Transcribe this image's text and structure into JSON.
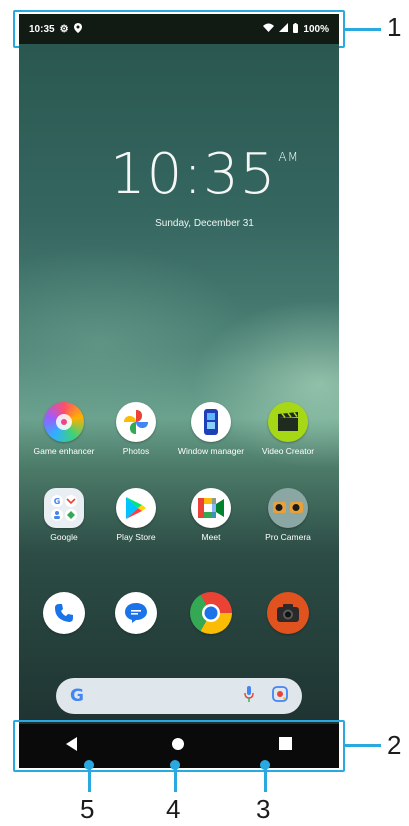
{
  "status_bar": {
    "time": "10:35",
    "battery": "100%",
    "icons": [
      "gear-icon",
      "location-icon",
      "wifi-icon",
      "signal-icon",
      "battery-icon"
    ]
  },
  "lock_clock": {
    "time": "10:35",
    "ampm": "AM",
    "date": "Sunday, December 31"
  },
  "apps": [
    {
      "label": "Game enhancer",
      "icon": "game-enhancer-icon"
    },
    {
      "label": "Photos",
      "icon": "photos-icon"
    },
    {
      "label": "Window manager",
      "icon": "window-manager-icon"
    },
    {
      "label": "Video Creator",
      "icon": "video-creator-icon"
    },
    {
      "label": "Google",
      "icon": "google-folder-icon"
    },
    {
      "label": "Play Store",
      "icon": "play-store-icon"
    },
    {
      "label": "Meet",
      "icon": "meet-icon"
    },
    {
      "label": "Pro Camera",
      "icon": "pro-camera-icon"
    }
  ],
  "dock": [
    "phone-icon",
    "messages-icon",
    "chrome-icon",
    "camera-icon"
  ],
  "search": {
    "logo": "G",
    "icons": [
      "mic-icon",
      "lens-icon"
    ]
  },
  "nav": [
    "back-icon",
    "home-icon",
    "recents-icon"
  ],
  "callouts": {
    "c1": "1",
    "c2": "2",
    "c3": "3",
    "c4": "4",
    "c5": "5"
  },
  "colors": {
    "accent": "#2aa9e0",
    "navbar": "#0a0a0a"
  }
}
